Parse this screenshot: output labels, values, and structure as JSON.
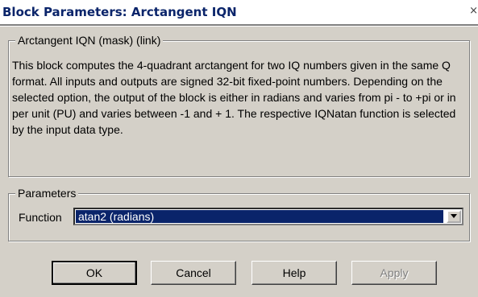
{
  "window": {
    "title": "Block Parameters: Arctangent IQN",
    "close_glyph": "×"
  },
  "mask_group": {
    "legend": "Arctangent IQN (mask) (link)",
    "description": "This block computes the 4-quadrant arctangent for two IQ numbers given in the same Q format. All inputs and outputs are signed 32-bit fixed-point numbers. Depending on the selected option, the output of the block is either in radians and varies from pi - to +pi or in per unit (PU) and varies between -1 and + 1. The respective IQNatan function is selected by the input data type."
  },
  "parameters_group": {
    "legend": "Parameters",
    "function_label": "Function",
    "function_value": "atan2 (radians)"
  },
  "buttons": {
    "ok": "OK",
    "cancel": "Cancel",
    "help": "Help",
    "apply": "Apply"
  }
}
